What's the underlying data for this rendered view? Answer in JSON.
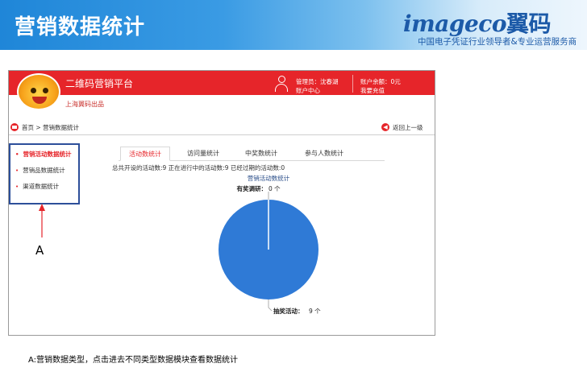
{
  "slide": {
    "title": "营销数据统计",
    "brand_logo_latin": "imageco",
    "brand_logo_cn": "翼码",
    "brand_tagline": "中国电子凭证行业领导者&专业运营服务商",
    "annotation_label": "A",
    "caption": "A:营销数据类型，点击进去不同类型数据模块查看数据统计",
    "colors": {
      "header_blue": "#1f86d8",
      "app_red": "#e6252a",
      "annotation_box": "#2d4f9a",
      "pie_blue": "#2f7ad6"
    }
  },
  "app": {
    "platform_title": "二维码营销平台",
    "sub_brand": "上海翼码出品",
    "admin": "管理员：沈春湖",
    "account_center": "账户中心",
    "balance": "账户余额：0元",
    "recharge": "我要充值",
    "breadcrumb": "首页 > 营销数据统计",
    "back_link": "返回上一级",
    "side_nav": [
      {
        "label": "营销活动数据统计",
        "active": true
      },
      {
        "label": "营销品数据统计",
        "active": false
      },
      {
        "label": "渠道数据统计",
        "active": false
      }
    ],
    "tabs": [
      {
        "label": "活动数统计",
        "active": true
      },
      {
        "label": "访问量统计",
        "active": false
      },
      {
        "label": "中奖数统计",
        "active": false
      },
      {
        "label": "参与人数统计",
        "active": false
      }
    ],
    "summary": "总共开设的活动数:9 正在进行中的活动数:9 已经过期的活动数:0"
  },
  "chart_data": {
    "type": "pie",
    "title": "营销活动数统计",
    "categories": [
      "有奖调研",
      "抽奖活动"
    ],
    "values": [
      0,
      9
    ],
    "unit": "个",
    "colors": [
      "#ffffff",
      "#2f7ad6"
    ]
  }
}
